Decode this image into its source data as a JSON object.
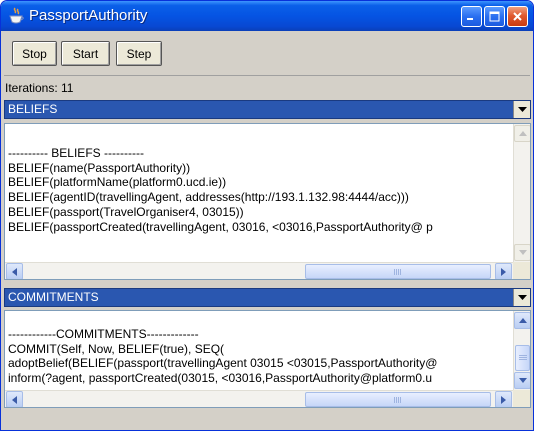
{
  "window": {
    "title": "PassportAuthority",
    "icon": "java-cup-icon"
  },
  "toolbar": {
    "stop_label": "Stop",
    "start_label": "Start",
    "step_label": "Step"
  },
  "status": {
    "iterations": "Iterations: 11"
  },
  "beliefs": {
    "selected": "BELIEFS",
    "lines": [
      "---------- BELIEFS ----------",
      "BELIEF(name(PassportAuthority))",
      "BELIEF(platformName(platform0.ucd.ie))",
      "BELIEF(agentID(travellingAgent, addresses(http://193.1.132.98:4444/acc)))",
      "BELIEF(passport(TravelOrganiser4, 03015))",
      "BELIEF(passportCreated(travellingAgent, 03016, <03016,PassportAuthority@ p"
    ]
  },
  "commitments": {
    "selected": "COMMITMENTS",
    "lines": [
      "------------COMMITMENTS-------------",
      "COMMIT(Self, Now, BELIEF(true), SEQ(",
      "adoptBelief(BELIEF(passport(travellingAgent 03015 <03015,PassportAuthority@",
      "inform(?agent, passportCreated(03015, <03016,PassportAuthority@platform0.u"
    ]
  },
  "colors": {
    "titlebar": "#0554e3",
    "combo_selected": "#2a57b0",
    "window_bg": "#d4d0c8"
  }
}
